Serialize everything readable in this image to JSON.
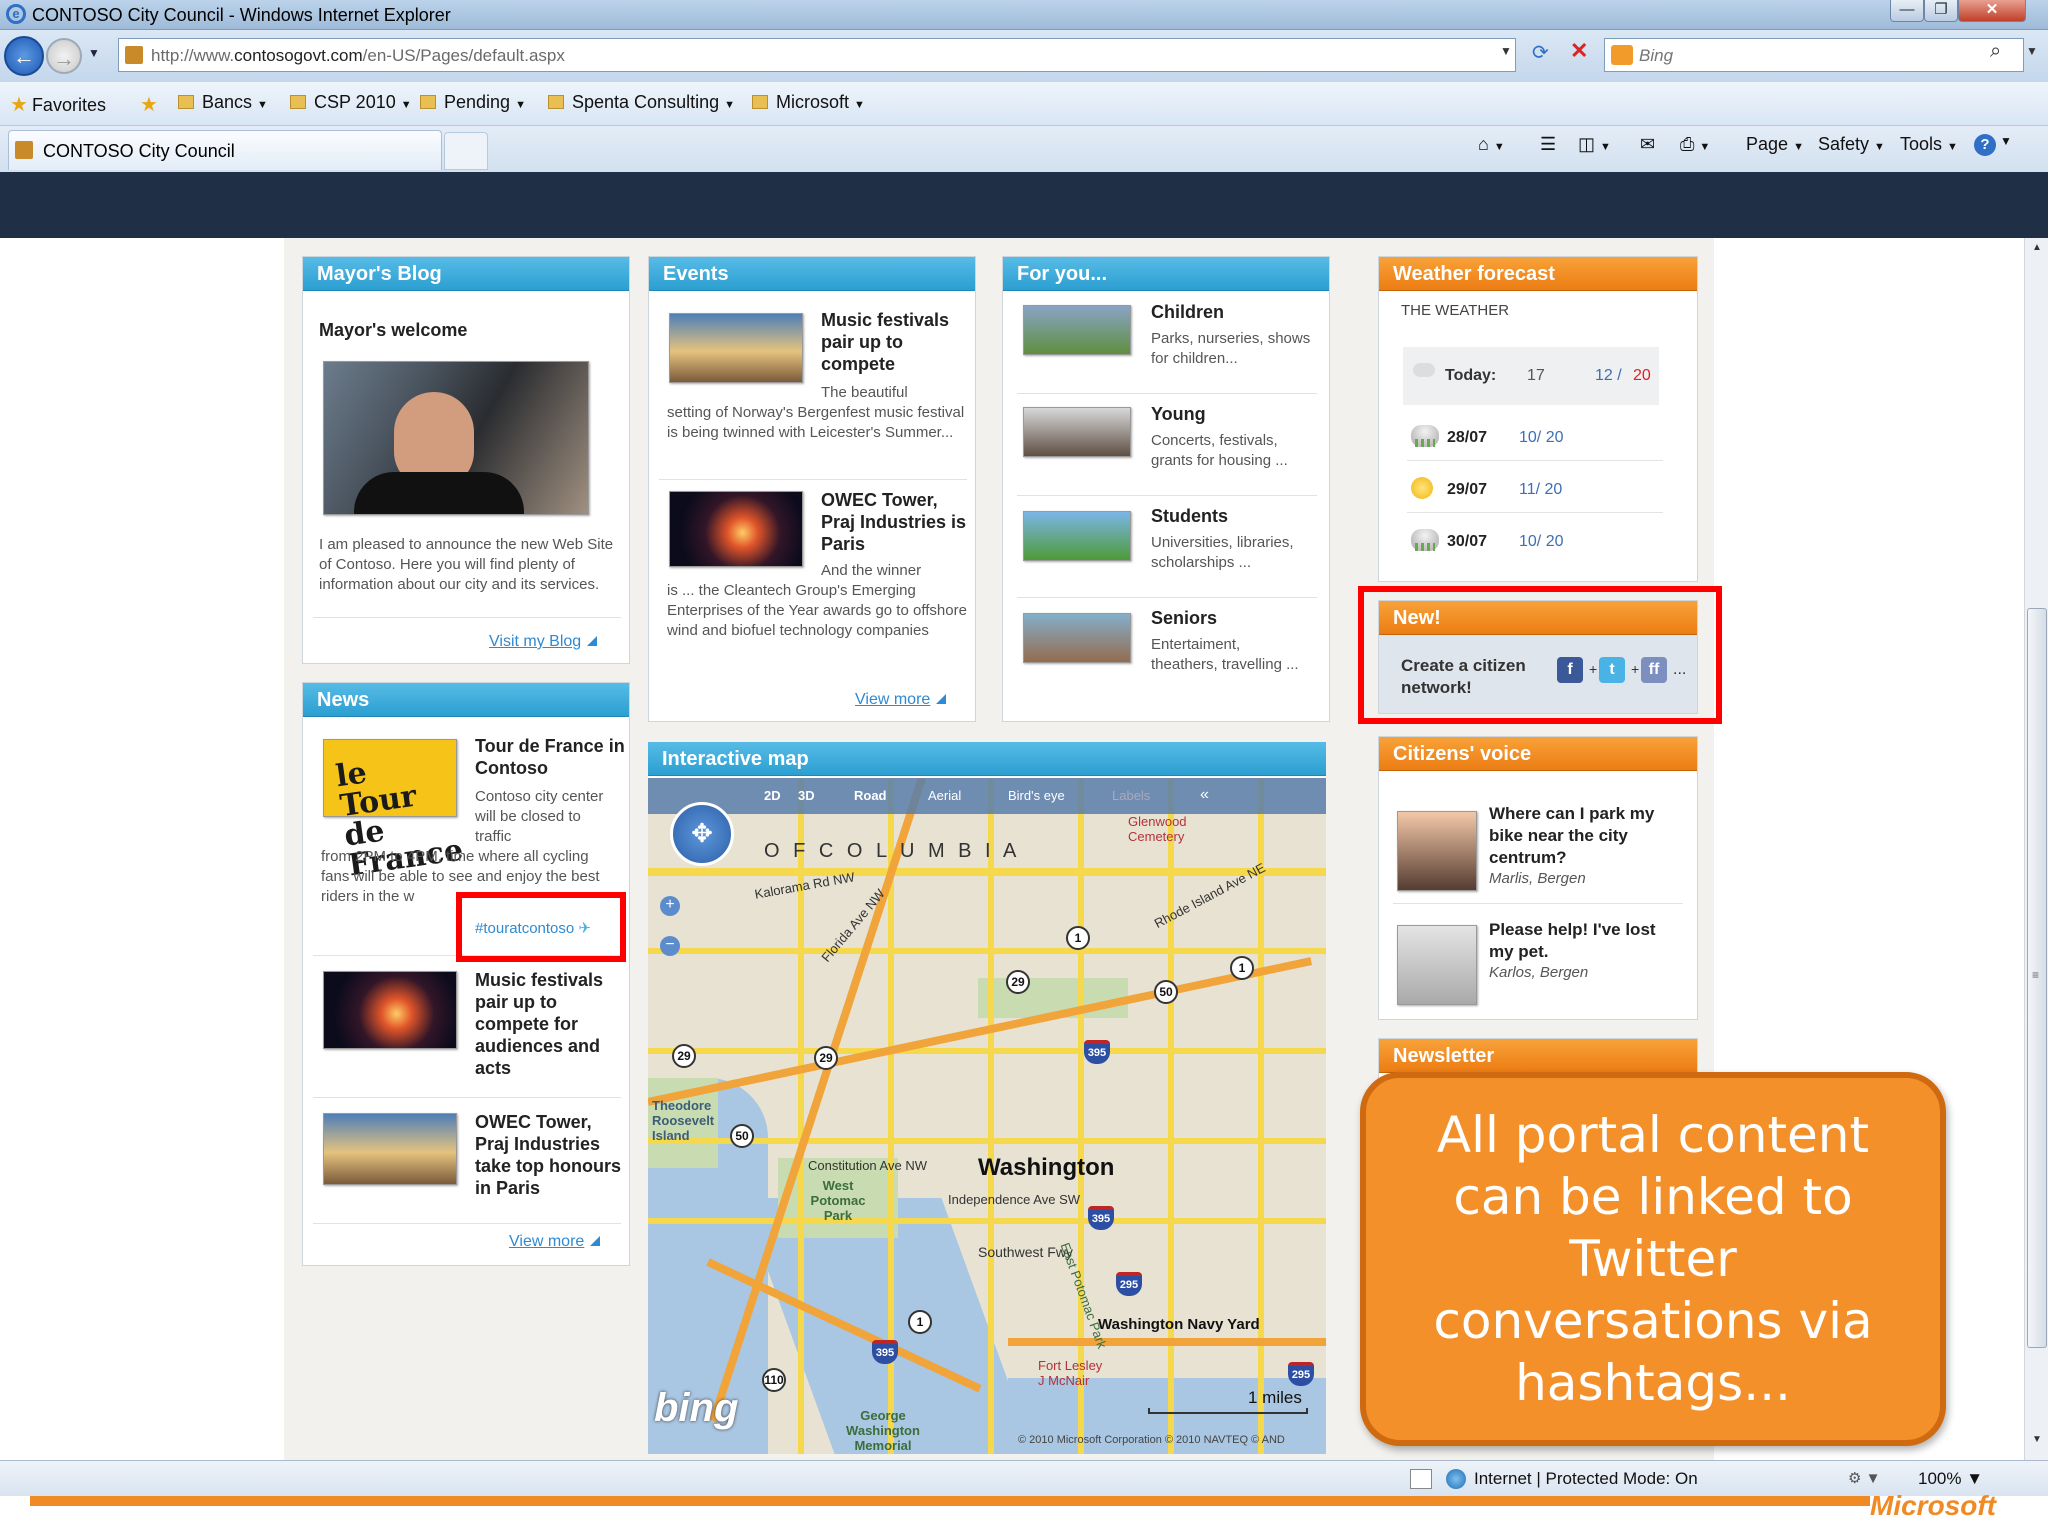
{
  "window": {
    "title": "CONTOSO City Council - Windows Internet Explorer",
    "min": "—",
    "max": "❐",
    "close": "✕"
  },
  "address": {
    "url_prefix": "http://www.",
    "url_domain": "contosogovt.com",
    "url_path": "/en-US/Pages/default.aspx",
    "search_placeholder": "Bing"
  },
  "favorites_bar": {
    "favorites": "Favorites",
    "folders": [
      "Bancs",
      "CSP 2010",
      "Pending",
      "Spenta Consulting",
      "Microsoft"
    ]
  },
  "tab": {
    "label": "CONTOSO City Council"
  },
  "commands": {
    "page": "Page",
    "safety": "Safety",
    "tools": "Tools",
    "help": "?"
  },
  "mayors_blog": {
    "header": "Mayor's Blog",
    "title": "Mayor's welcome",
    "body": "I am pleased to announce the new Web Site of Contoso. Here you will find plenty of information about our city and its services.",
    "link": "Visit my Blog"
  },
  "news": {
    "header": "News",
    "items": [
      {
        "title": "Tour de France in Contoso",
        "body_a": "Contoso city center will be closed to traffic",
        "body_b": "from 2PM to 4PM, time where all cycling fans will be able to see and enjoy the best riders in the w",
        "hashtag": "#touratcontoso",
        "logo_text": "le Tour de France"
      },
      {
        "title": "Music festivals pair up to compete for audiences and acts"
      },
      {
        "title": "OWEC Tower, Praj Industries take top honours in Paris"
      }
    ],
    "link": "View more"
  },
  "events": {
    "header": "Events",
    "items": [
      {
        "title": "Music festivals pair up to compete",
        "body_a": "The beautiful",
        "body_b": "setting of Norway's Bergenfest music festival is being twinned with Leicester's Summer..."
      },
      {
        "title": "OWEC Tower, Praj Industries is Paris",
        "body_a": "And the winner",
        "body_b": "is ... the Cleantech Group's Emerging Enterprises of the Year awards go to offshore wind and biofuel technology companies"
      }
    ],
    "link": "View more"
  },
  "for_you": {
    "header": "For you...",
    "items": [
      {
        "title": "Children",
        "body": "Parks, nurseries, shows for children..."
      },
      {
        "title": "Young",
        "body": "Concerts, festivals, grants for housing ..."
      },
      {
        "title": "Students",
        "body": "Universities, libraries, scholarships ..."
      },
      {
        "title": "Seniors",
        "body": "Entertaiment, theathers, travelling ..."
      }
    ]
  },
  "weather": {
    "header": "Weather forecast",
    "subheader": "THE WEATHER",
    "today": {
      "label": "Today:",
      "current": "17",
      "range_low": "12 /",
      "range_high": "20"
    },
    "days": [
      {
        "date": "28/07",
        "range": "10/ 20",
        "icon": "rain-icon"
      },
      {
        "date": "29/07",
        "range": "11/ 20",
        "icon": "sun-icon"
      },
      {
        "date": "30/07",
        "range": "10/ 20",
        "icon": "rain-icon"
      }
    ]
  },
  "new_box": {
    "header": "New!",
    "text": "Create a citizen network!",
    "more": "..."
  },
  "citizens_voice": {
    "header": "Citizens' voice",
    "items": [
      {
        "title": "Where can I park my bike near the city centrum?",
        "author": "Marlis, Bergen"
      },
      {
        "title": "Please help! I've lost my pet.",
        "author": "Karlos, Bergen"
      }
    ]
  },
  "newsletter": {
    "header": "Newsletter"
  },
  "map": {
    "header": "Interactive map",
    "modes": [
      "2D",
      "3D",
      "Road",
      "Aerial",
      "Bird's eye",
      "Labels"
    ],
    "labels": {
      "city": "Washington",
      "columbia": "O F   C O L U M B I A",
      "navy": "Washington Navy Yard",
      "cemetery": "Glenwood Cemetery",
      "island": "Theodore Roosevelt Island",
      "potomac": "West Potomac Park",
      "fort": "Fort Lesley J McNair",
      "gwmem": "George Washington Memorial",
      "constitution": "Constitution Ave NW",
      "independence": "Independence Ave SW",
      "southwest": "Southwest Fwy",
      "east_potomac": "East Potomac Park",
      "rhode": "Rhode Island Ave NE",
      "kalorama": "Kalorama Rd NW",
      "florida": "Florida Ave NW",
      "scale": "1 miles",
      "copyright": "© 2010 Microsoft Corporation   © 2010 NAVTEQ   © AND",
      "bing": "bing"
    }
  },
  "status": {
    "zone": "Internet | Protected Mode: On",
    "zoom": "100%"
  },
  "branding": {
    "microsoft": "Microsoft"
  },
  "callout": {
    "text": "All portal content can be linked to Twitter conversations via hashtags..."
  }
}
